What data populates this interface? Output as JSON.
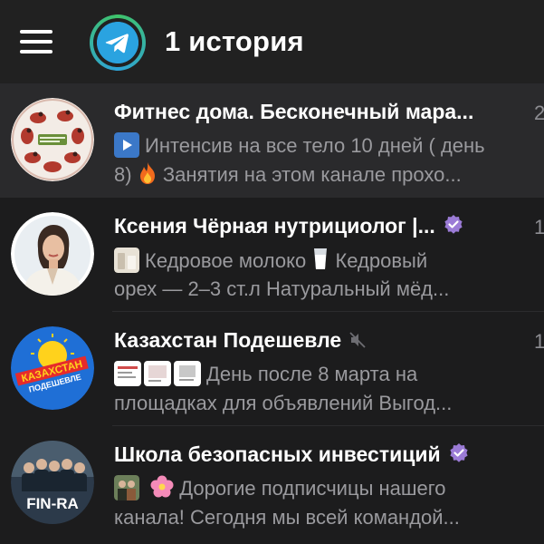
{
  "header": {
    "title": "1 история",
    "menu_icon": "hamburger-menu-icon",
    "story_icon": "telegram-logo-icon"
  },
  "colors": {
    "background": "#1c1c1d",
    "header": "#212121",
    "selected_row": "#2a2a2c",
    "secondary_text": "#9a9a9e",
    "verified": "#9b7bd6",
    "story_ring": "#3fc36a"
  },
  "chats": [
    {
      "title": "Фитнес дома. Бесконечный мара...",
      "date": "2",
      "preview_line1": "Интенсив на все тело 10 дней ( день",
      "preview_line2_a": "8)",
      "preview_line2_b": "Занятия на этом канале прохо...",
      "selected": true
    },
    {
      "title": "Ксения Чёрная нутрициолог |...",
      "date": "1",
      "verified": true,
      "preview_line1_a": "Кедровое молоко",
      "preview_line1_b": "Кедровый",
      "preview_line2": "орех — 2–3 ст.л Натуральный мёд..."
    },
    {
      "title": "Казахстан Подешевле",
      "date": "1",
      "muted": true,
      "avatar_text_1": "КАЗАХСТАН",
      "avatar_text_2": "ПОДЕШЕВЛЕ",
      "preview_line1": "День после 8 марта на",
      "preview_line2": "площадках для объявлений  Выгод..."
    },
    {
      "title": "Школа безопасных инвестиций",
      "date": "",
      "verified": true,
      "avatar_text": "FIN-RA",
      "preview_line1": "Дорогие подписчицы нашего",
      "preview_line2": "канала! Сегодня мы всей командой..."
    }
  ]
}
